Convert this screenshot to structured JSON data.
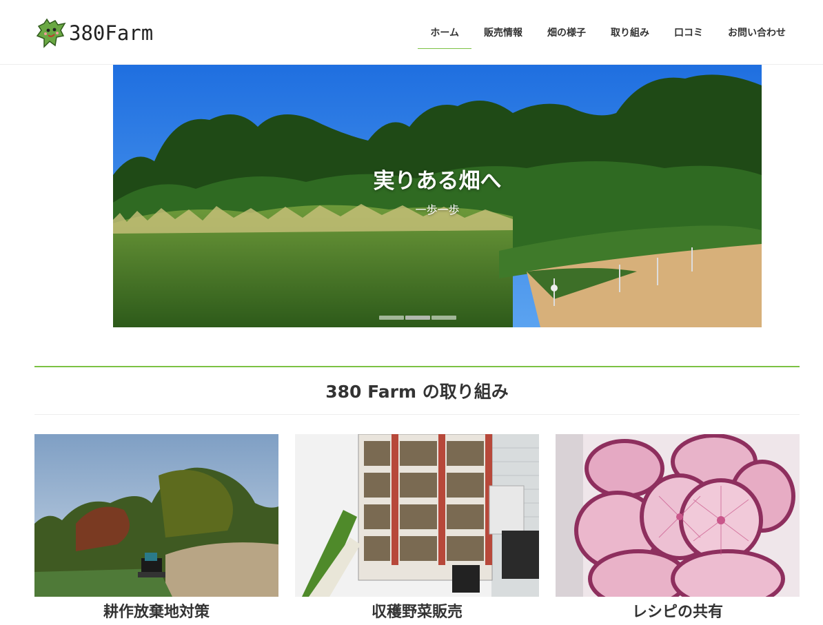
{
  "header": {
    "logo_text": "380Farm",
    "nav": [
      {
        "label": "ホーム",
        "active": true
      },
      {
        "label": "販売情報",
        "active": false
      },
      {
        "label": "畑の様子",
        "active": false
      },
      {
        "label": "取り組み",
        "active": false
      },
      {
        "label": "口コミ",
        "active": false
      },
      {
        "label": "お問い合わせ",
        "active": false
      }
    ]
  },
  "hero": {
    "title": "実りある畑へ",
    "subtitle": "一歩一歩",
    "slide_count": 3,
    "active_slide": 2
  },
  "section": {
    "title": "380 Farm の取り組み",
    "accent_color": "#7bc143",
    "cards": [
      {
        "title": "耕作放棄地対策",
        "image": "field-clearing-photo"
      },
      {
        "title": "収穫野菜販売",
        "image": "vegetable-locker-photo"
      },
      {
        "title": "レシピの共有",
        "image": "sliced-radish-photo"
      }
    ]
  }
}
